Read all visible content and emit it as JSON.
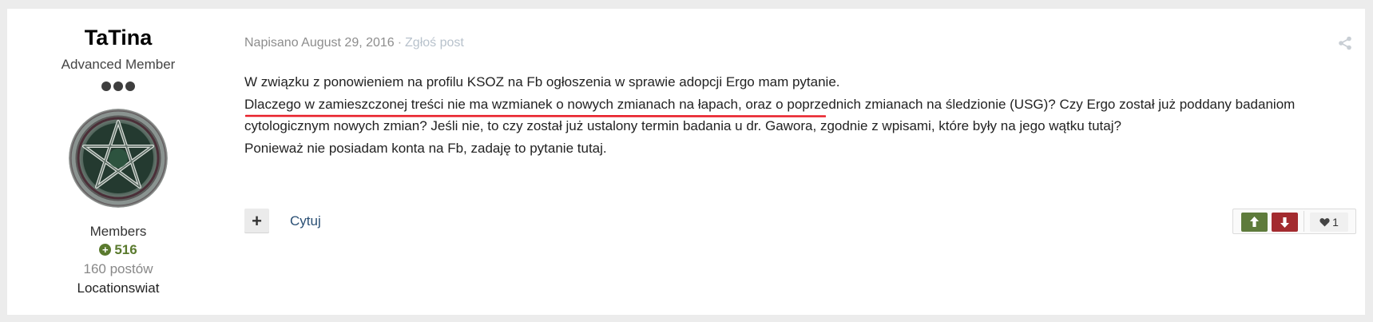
{
  "author": {
    "username": "TaTina",
    "member_title": "Advanced Member",
    "group": "Members",
    "reputation": "516",
    "posts_count": "160 postów",
    "location": "Locationswiat"
  },
  "post": {
    "meta_prefix": "Napisano August 29, 2016",
    "meta_separator": "·",
    "report_label": "Zgłoś post",
    "paragraphs": [
      "W związku z ponowieniem na profilu KSOZ na Fb ogłoszenia w sprawie adopcji Ergo mam pytanie.",
      "Dlaczego w zamieszczonej treści nie ma wzmianek o nowych zmianach na łapach, oraz o poprzednich zmianach na śledzionie (USG)? Czy Ergo został już poddany badaniom cytologicznym nowych zmian? Jeśli nie, to czy został już ustalony termin badania u dr. Gawora, zgodnie z wpisami, które były na jego wątku tutaj?",
      "Ponieważ nie posiadam konta na Fb, zadaję to pytanie tutaj."
    ]
  },
  "actions": {
    "multiquote_symbol": "+",
    "quote_label": "Cytuj",
    "like_count": "1"
  },
  "colors": {
    "vote_up": "#5e7b3b",
    "vote_down": "#a32b2f",
    "annotation_underline": "#e8202a"
  },
  "icons": {
    "share": "share-icon",
    "reputation": "plus-circle-icon",
    "vote_up": "arrow-up-icon",
    "vote_down": "arrow-down-icon",
    "like": "heart-icon"
  }
}
